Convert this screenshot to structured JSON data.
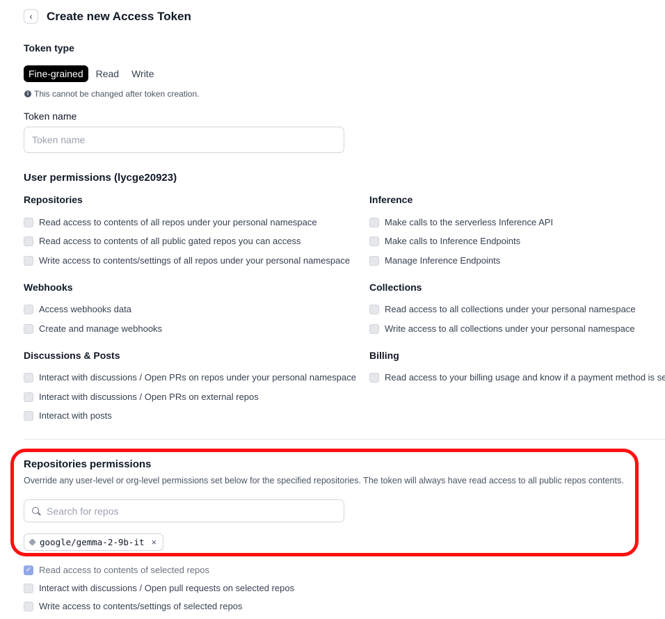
{
  "header": {
    "back_icon": "chevron-left-icon",
    "title": "Create new Access Token"
  },
  "token_type": {
    "label": "Token type",
    "tabs": [
      {
        "label": "Fine-grained",
        "active": true
      },
      {
        "label": "Read",
        "active": false
      },
      {
        "label": "Write",
        "active": false
      }
    ],
    "note": "This cannot be changed after token creation."
  },
  "token_name": {
    "label": "Token name",
    "placeholder": "Token name",
    "value": ""
  },
  "user_permissions": {
    "title": "User permissions (lycge20923)",
    "groups": {
      "repositories": {
        "title": "Repositories",
        "items": [
          "Read access to contents of all repos under your personal namespace",
          "Read access to contents of all public gated repos you can access",
          "Write access to contents/settings of all repos under your personal namespace"
        ]
      },
      "inference": {
        "title": "Inference",
        "items": [
          "Make calls to the serverless Inference API",
          "Make calls to Inference Endpoints",
          "Manage Inference Endpoints"
        ]
      },
      "webhooks": {
        "title": "Webhooks",
        "items": [
          "Access webhooks data",
          "Create and manage webhooks"
        ]
      },
      "collections": {
        "title": "Collections",
        "items": [
          "Read access to all collections under your personal namespace",
          "Write access to all collections under your personal namespace"
        ]
      },
      "discussions": {
        "title": "Discussions & Posts",
        "items": [
          "Interact with discussions / Open PRs on repos under your personal namespace",
          "Interact with discussions / Open PRs on external repos",
          "Interact with posts"
        ]
      },
      "billing": {
        "title": "Billing",
        "items": [
          "Read access to your billing usage and know if a payment method is set"
        ]
      }
    }
  },
  "repositories_permissions": {
    "title": "Repositories permissions",
    "description": "Override any user-level or org-level permissions set below for the specified repositories. The token will always have read access to all public repos contents.",
    "search_placeholder": "Search for repos",
    "selected_repo": "google/gemma-2-9b-it",
    "remove_glyph": "×",
    "items": [
      {
        "label": "Read access to contents of selected repos",
        "checked": true
      },
      {
        "label": "Interact with discussions / Open pull requests on selected repos",
        "checked": false
      },
      {
        "label": "Write access to contents/settings of selected repos",
        "checked": false
      }
    ]
  },
  "colors": {
    "highlight": "#ff1010",
    "active_tab": "#000000",
    "checked": "#93a8e8"
  }
}
